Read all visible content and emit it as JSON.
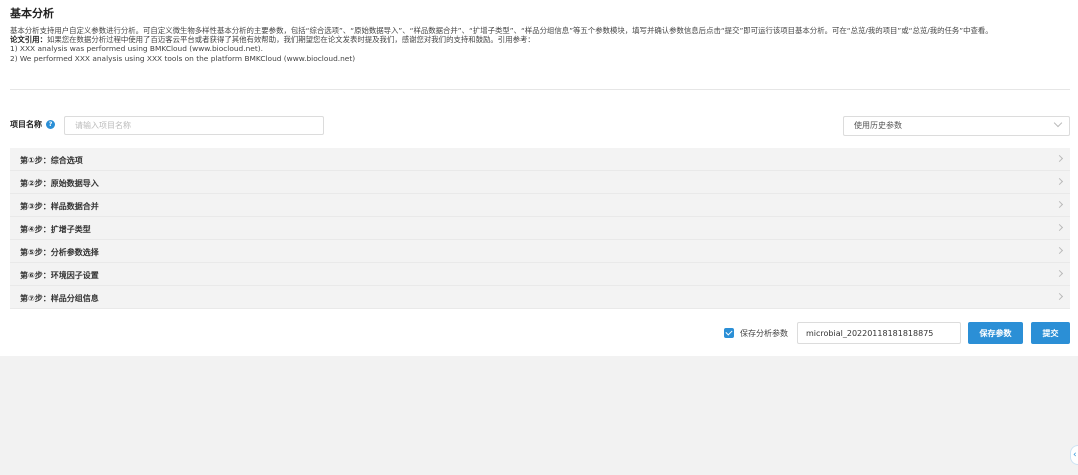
{
  "header": {
    "title": "基本分析"
  },
  "description": {
    "line1": "基本分析支持用户自定义参数进行分析。可自定义微生物多样性基本分析的主要参数，包括“综合选项”、“原始数据导入”、“样品数据合并”、“扩增子类型”、“样品分组信息”等五个参数模块，填写并确认参数信息后点击“提交”即可运行该项目基本分析。可在“总览/我的项目”或“总览/我的任务”中查看。",
    "citation_label": "论文引用：",
    "citation_text": "如果您在数据分析过程中使用了百迈客云平台或者获得了其他有效帮助，我们期望您在论文发表时提及我们，感谢您对我们的支持和鼓励。引用参考：",
    "ref1": "1) XXX analysis was performed using BMKCloud (www.biocloud.net).",
    "ref2": "2) We performed XXX analysis using XXX tools on the platform BMKCloud (www.biocloud.net)"
  },
  "project": {
    "label": "项目名称",
    "placeholder": "请输入项目名称",
    "history_select": "使用历史参数"
  },
  "steps": [
    {
      "label": "第①步：综合选项"
    },
    {
      "label": "第②步：原始数据导入"
    },
    {
      "label": "第③步：样品数据合并"
    },
    {
      "label": "第④步：扩增子类型"
    },
    {
      "label": "第⑤步：分析参数选择"
    },
    {
      "label": "第⑥步：环境因子设置"
    },
    {
      "label": "第⑦步：样品分组信息"
    }
  ],
  "save": {
    "checkbox_label": "保存分析参数",
    "param_name": "microbial_20220118181818875",
    "save_button": "保存参数",
    "submit_button": "提交"
  },
  "colors": {
    "accent": "#2b8fd6",
    "step_bg": "#f3f3f3",
    "page_bg": "#f2f2f2"
  }
}
